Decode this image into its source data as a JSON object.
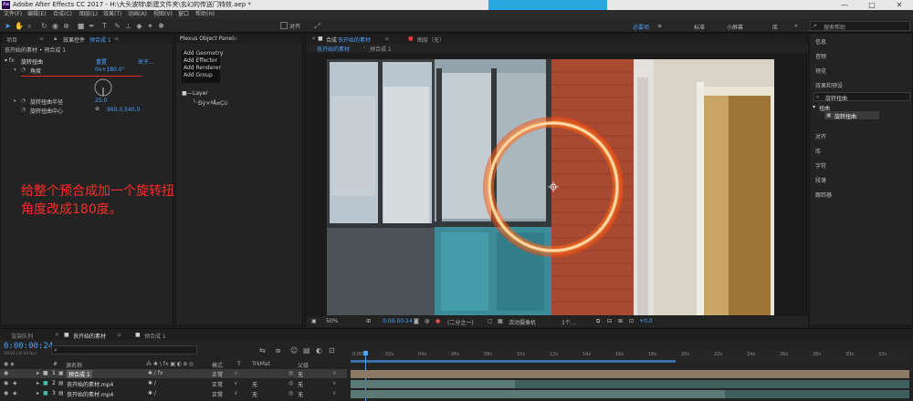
{
  "window": {
    "title": "Adobe After Effects CC 2017 - H:\\大头波特\\新建文件夹\\玄幻的传送门特效.aep *",
    "app_icon": "Ae",
    "minimize": "—",
    "maximize": "□",
    "close": "✕"
  },
  "menu": [
    "文件(F)",
    "编辑(E)",
    "合成(C)",
    "图层(L)",
    "效果(T)",
    "动画(A)",
    "视图(V)",
    "窗口",
    "帮助(H)"
  ],
  "toolbar": {
    "snap_label": "对齐",
    "workspaces": [
      "必要项",
      "标准",
      "小屏幕",
      "库"
    ],
    "active_workspace": "必要项",
    "search_placeholder": "搜索帮助"
  },
  "effect_controls": {
    "tabs": [
      "项目",
      "效果控件 预合成 1"
    ],
    "project_tab": "项目",
    "panel_tab_prefix": "效果控件",
    "panel_tab_subject": "预合成 1",
    "breadcrumb": "丧开始的素材 • 预合成 1",
    "effect_name": "旋转扭曲",
    "reset": "重置",
    "about": "关于...",
    "prop_angle_label": "角度",
    "prop_angle_value": "0x+180.0°",
    "prop_radius_label": "旋转扭曲半径",
    "prop_radius_value": "25.0",
    "prop_center_label": "旋转扭曲中心",
    "prop_center_value": "960.0,540.0"
  },
  "annotation": {
    "line1": "给整个预合成加一个旋转扭曲的效果，然后把",
    "line2": "角度改成180度。"
  },
  "plexus": {
    "title": "Plexus Object Panel",
    "menu_items": [
      "Add Geometry",
      "Add Effector",
      "Add Renderer",
      "Add Group"
    ],
    "layer_label": "Layer",
    "layer_child": "Ðý×ªÅ¤Çú"
  },
  "composition": {
    "tab_prefix": "合成",
    "tab_name": "丧开始的素材",
    "layer_tab": "图层（无）",
    "sub_tabs": [
      "丧开始的素材",
      "预合成 1"
    ],
    "zoom": "50%",
    "timecode": "0:00:00:24",
    "resolution": "(二分之一)",
    "camera": "活动摄像机",
    "views": "1个...",
    "exposure": "+0.0"
  },
  "right_panels": {
    "items_top": [
      "信息",
      "音频",
      "预览",
      "效果和预设"
    ],
    "search_value": "旋转扭曲",
    "category": "扭曲",
    "effect_result": "旋转扭曲",
    "items_bottom": [
      "对齐",
      "库",
      "字符",
      "段落",
      "跟踪器"
    ]
  },
  "timeline": {
    "tabs": [
      "渲染队列",
      "丧开始的素材",
      "预合成 1"
    ],
    "timecode": "0:00:00:24",
    "framerate": "00024 (30.00 fps)",
    "columns": {
      "num": "#",
      "source": "源名称",
      "mode": "模式",
      "t": "T",
      "trkmat": "TrkMat",
      "parent": "父级"
    },
    "ruler_ticks": [
      "0:00s",
      "02s",
      "04s",
      "06s",
      "08s",
      "10s",
      "12s",
      "14s",
      "16s",
      "18s",
      "20s",
      "22s",
      "24s",
      "26s",
      "28s",
      "30s",
      "32s"
    ],
    "layers": [
      {
        "num": "1",
        "name": "预合成 1",
        "mode": "正常",
        "trkmat": "",
        "parent": "无"
      },
      {
        "num": "2",
        "name": "丧开始的素材.mp4",
        "mode": "正常",
        "trkmat": "无",
        "parent": "无"
      },
      {
        "num": "3",
        "name": "丧开始的素材.mp4",
        "mode": "正常",
        "trkmat": "无",
        "parent": "无"
      }
    ]
  },
  "colors": {
    "accent": "#4aa3ff",
    "annotation": "#ff2a2a",
    "portal": "#ff6a1a"
  }
}
